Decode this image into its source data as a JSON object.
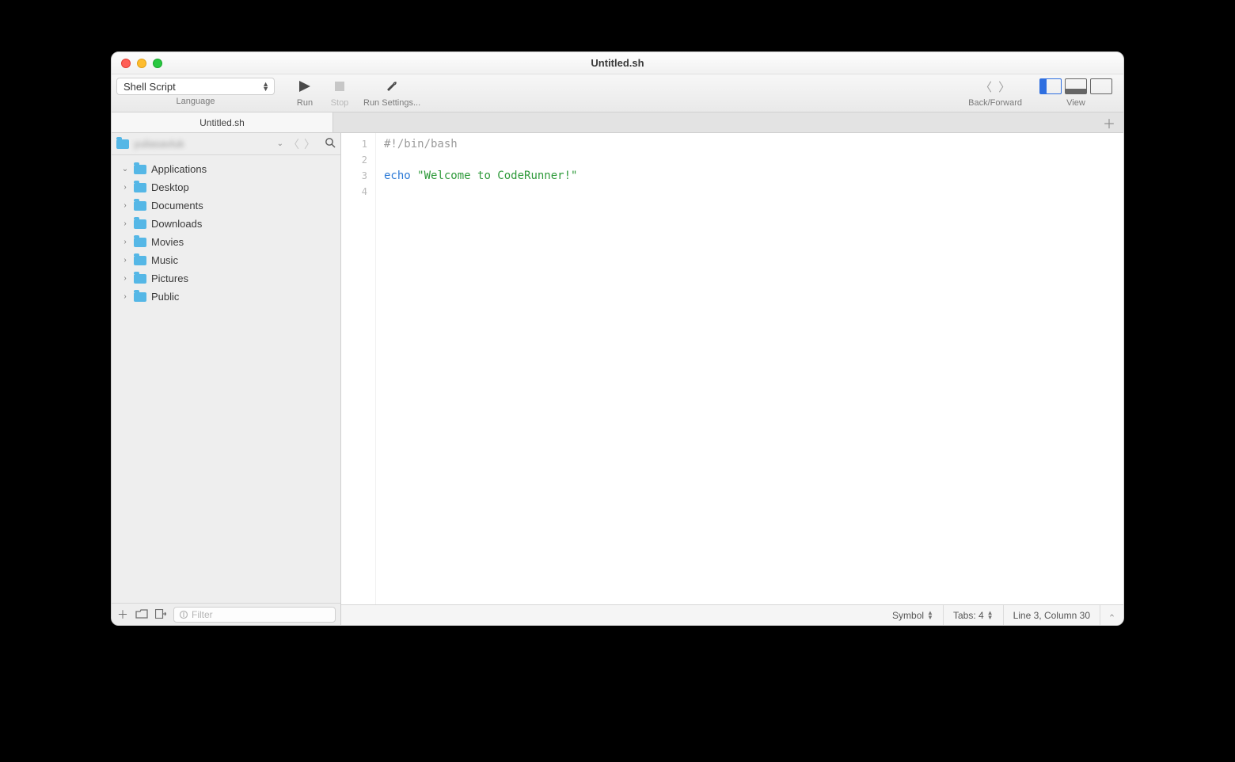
{
  "window": {
    "title": "Untitled.sh"
  },
  "toolbar": {
    "language": {
      "label": "Language",
      "value": "Shell Script"
    },
    "run": {
      "label": "Run"
    },
    "stop": {
      "label": "Stop"
    },
    "run_settings": {
      "label": "Run Settings..."
    },
    "back_forward": {
      "label": "Back/Forward"
    },
    "view": {
      "label": "View"
    }
  },
  "tabs": [
    {
      "label": "Untitled.sh"
    }
  ],
  "sidebar": {
    "root_user": "yuliasavluk",
    "items": [
      {
        "label": "Applications",
        "expanded": true
      },
      {
        "label": "Desktop",
        "expanded": false
      },
      {
        "label": "Documents",
        "expanded": false
      },
      {
        "label": "Downloads",
        "expanded": false
      },
      {
        "label": "Movies",
        "expanded": false
      },
      {
        "label": "Music",
        "expanded": false
      },
      {
        "label": "Pictures",
        "expanded": false
      },
      {
        "label": "Public",
        "expanded": false
      }
    ],
    "filter_placeholder": "Filter"
  },
  "editor": {
    "lines": [
      {
        "n": 1,
        "segments": [
          {
            "t": "#!/bin/bash",
            "c": "comment"
          }
        ]
      },
      {
        "n": 2,
        "segments": []
      },
      {
        "n": 3,
        "segments": [
          {
            "t": "echo ",
            "c": "keyword"
          },
          {
            "t": "\"Welcome to CodeRunner!\"",
            "c": "string"
          }
        ]
      },
      {
        "n": 4,
        "segments": []
      }
    ]
  },
  "statusbar": {
    "symbol": "Symbol",
    "tabs": "Tabs: 4",
    "pos": "Line 3, Column 30"
  }
}
